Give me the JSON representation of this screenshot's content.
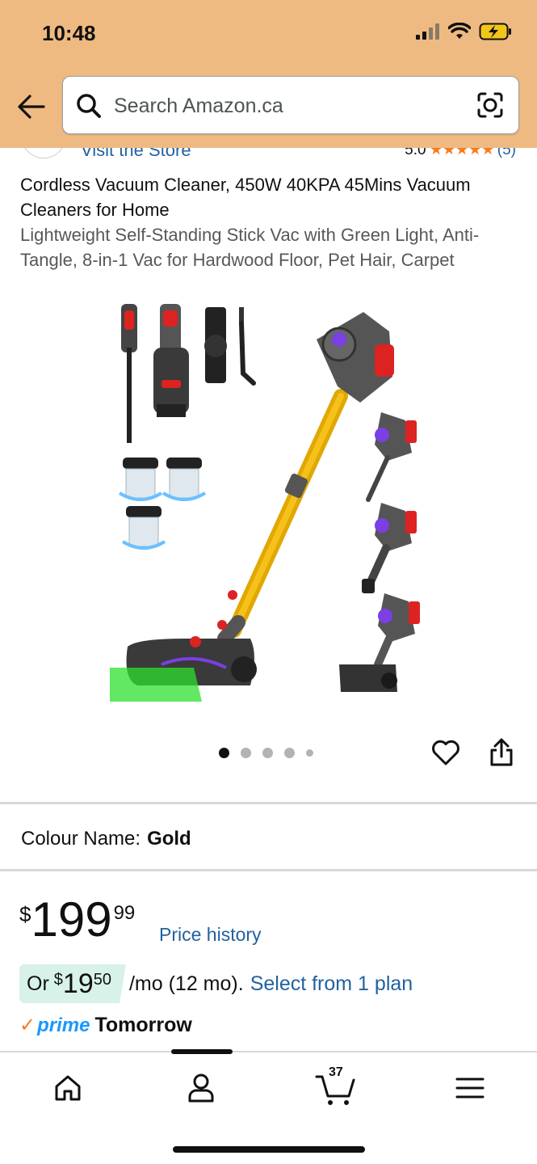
{
  "status_bar": {
    "time": "10:48"
  },
  "search": {
    "placeholder": "Search Amazon.ca"
  },
  "store": {
    "link_label": "Visit the Store",
    "rating_value": "5.0",
    "rating_count": "(5)",
    "stars": 5
  },
  "product": {
    "title": "Cordless Vacuum Cleaner, 450W 40KPA 45Mins Vacuum Cleaners for Home",
    "subtitle": "Lightweight Self-Standing Stick Vac with Green Light, Anti-Tangle, 8-in-1 Vac for Hardwood Floor, Pet Hair, Carpet",
    "image_count": 5,
    "active_image": 1,
    "colour_label": "Colour Name:",
    "colour_value": "Gold"
  },
  "price": {
    "symbol": "$",
    "whole": "199",
    "fraction": "99",
    "history_label": "Price history"
  },
  "installment": {
    "prefix": "Or",
    "symbol": "$",
    "whole": "19",
    "fraction": "50",
    "suffix": "/mo (12 mo).",
    "plan_link": "Select from 1 plan"
  },
  "delivery": {
    "prime_label": "prime",
    "day": "Tomorrow"
  },
  "bottom_nav": {
    "items": [
      "home-icon",
      "account-icon",
      "cart-icon",
      "menu-icon"
    ],
    "cart_count": "37"
  },
  "colors": {
    "header_bg": "#efba82",
    "link": "#2162a1",
    "prime_blue": "#1a98ff",
    "star": "#f57c1f"
  }
}
